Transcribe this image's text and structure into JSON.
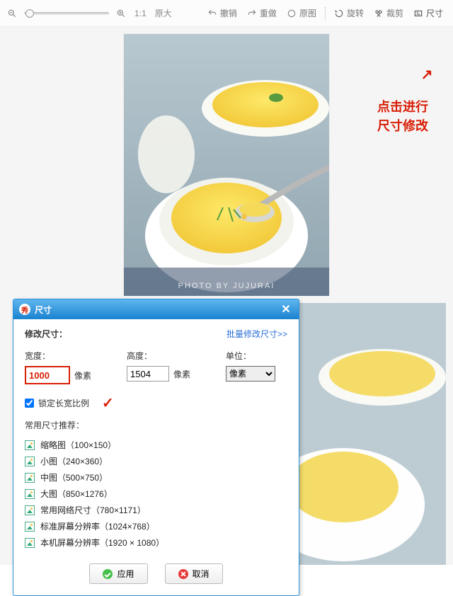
{
  "toolbar": {
    "ratio_label": "1:1",
    "original_label": "原大",
    "undo": "撤销",
    "redo": "重做",
    "original_image": "原图",
    "rotate": "旋转",
    "crop": "裁剪",
    "size": "尺寸"
  },
  "annotation": {
    "arrow": "↖",
    "line1": "点击进行",
    "line2": "尺寸修改"
  },
  "watermark": "PHOTO  BY  JUJURAI",
  "dialog": {
    "app_badge": "秀",
    "title": "尺寸",
    "section_label": "修改尺寸：",
    "batch_link": "批量修改尺寸>>",
    "width_label": "宽度：",
    "height_label": "高度：",
    "unit_label": "单位：",
    "pixel_suffix": "像素",
    "width_value": "1000",
    "height_value": "1504",
    "unit_value": "像素",
    "lock_ratio_label": "锁定长宽比例",
    "lock_checked": true,
    "check_glyph": "✓",
    "preset_label": "常用尺寸推荐：",
    "presets": [
      "缩略图（100×150）",
      "小图（240×360）",
      "中图（500×750）",
      "大图（850×1276）",
      "常用网络尺寸（780×1171）",
      "标准屏幕分辨率（1024×768）",
      "本机屏幕分辨率（1920 × 1080）"
    ],
    "apply": "应用",
    "cancel": "取消"
  }
}
